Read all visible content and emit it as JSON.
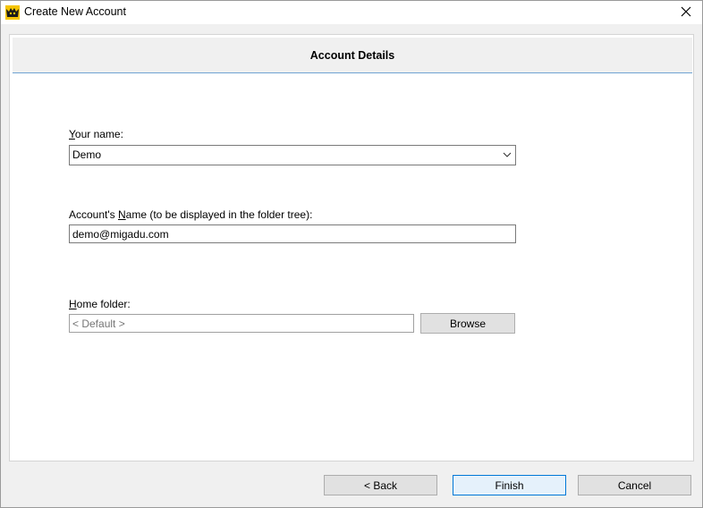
{
  "window": {
    "title": "Create New Account",
    "close_glyph": "✕"
  },
  "header": {
    "title": "Account Details"
  },
  "form": {
    "your_name": {
      "label_underlined": "Y",
      "label_rest": "our name:",
      "value": "Demo"
    },
    "account_name": {
      "label_before": "Account's ",
      "label_underlined": "N",
      "label_after": "ame (to be displayed in the folder tree):",
      "value": "demo@migadu.com"
    },
    "home_folder": {
      "label_underlined": "H",
      "label_rest": "ome folder:",
      "placeholder": "< Default >",
      "browse_label": "Browse"
    }
  },
  "footer": {
    "back_label": "<  Back",
    "finish_label": "Finish",
    "cancel_label": "Cancel"
  },
  "colors": {
    "accent": "#0078d7",
    "header_rule": "#6fa3d3"
  },
  "icons": {
    "app": "app-logo-icon",
    "close": "close-icon",
    "dropdown": "chevron-down-icon"
  }
}
